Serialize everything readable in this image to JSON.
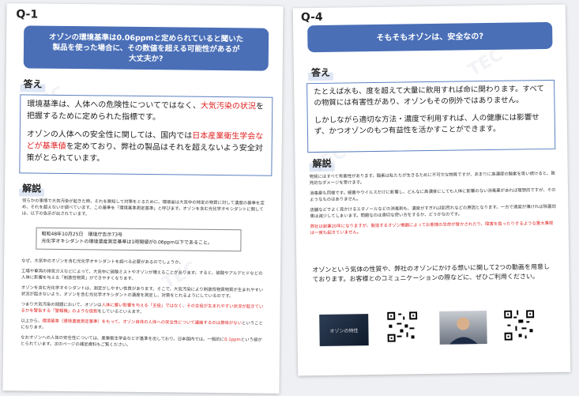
{
  "page1": {
    "qid": "Q-1",
    "question": [
      "オゾンの環境基準は0.06ppmと定められていると聞いた",
      "製品を使った場合に、その数値を超える可能性があるが",
      "大丈夫か?"
    ],
    "answer_heading": "答え",
    "answer": {
      "p1_a": "環境基準は、人体への危険性についてではなく、",
      "p1_red": "大気汚染の状況",
      "p1_b": "を把握するために定められた指標です。",
      "p2_a": "オゾンの人体への安全性に関しては、国内では",
      "p2_red": "日本産業衛生学会などが基準値",
      "p2_b": "を定めており、弊社の製品はそれを超えないよう安全対策がとられています。"
    },
    "explain_heading": "解説",
    "explain_1": "何らかの事情で大気汚染が起きた時、それを察知して対策をとるために、環境省は大気中の特定の物質に対して濃度の基準を定め、それを超えないか調べています。この基準を「環境基準測定基準」と呼びます。オゾンを含む光化学オキシダントに関しては、以下の告示が出されています。",
    "notice_1": "昭和48年10月25日　環境庁告示73号",
    "notice_2": "光化学オキシダントの環境濃度測定基準は1時間値が0.06ppm以下であること。",
    "explain_2": "なぜ、大気中のオゾンを含む光化学オキシダントを調べる必要があるのでしょうか。",
    "explain_3": "工場や車両の排気ガスなどによって、大気中に硫酸ミストやオゾンが増えることがあります。すると、硫酸やアルデヒドなどの人体に影響を与える「刺激性物質」ができやすくなります。",
    "explain_4": "オゾンを含む光化学オキシダントは、測定がしやすい性質があります。そこで、大気汚染により刺激性物質物質が生まれやすい状況が起きないよう、オゾンを含む光化学オキシダントの濃度を測定し、対策をとれるようにしているのです。",
    "explain_5_a": "つまり大気汚染の問題において、オゾンは",
    "explain_5_red": "人体に悪い影響を与える「主役」ではなく、その主役が生まれやすい状況が起きているかを警告する「警報機」のような役割",
    "explain_5_b": "をしているといえます。",
    "explain_6_a": "以上から、",
    "explain_6_red": "環境基準（環境濃度測定基準）をもって、オゾン自体の人体への安全性について議論するのは意味がない",
    "explain_6_b": "ということになります。",
    "explain_7_a": "なおオゾンへの人体の安全性については、産業衛生学会などが基準を出しており、日本国内では、一般的に",
    "explain_7_red": "0.1ppm",
    "explain_7_b": "という値がとられています。次のページの補足資料もご覧ください。"
  },
  "page2": {
    "qid": "Q-4",
    "question": "そもそもオゾンは、安全なの?",
    "answer_heading": "答え",
    "answer_p1": "たとえば水も、度を超えて大量に飲用すれば命に関わります。すべての物質には有害性があり、オゾンもその例外ではありません。",
    "answer_p2": "しかしながら適切な方法・濃度で利用すれば、人の健康には影響せず、かつオゾンのもつ有益性を活かすことができます。",
    "explain_heading": "解説",
    "explain_1": "物質にはすべて有害性があります。酸素は私たちが生きるために不可欠な物質ですが、あまりに高濃度の酸素を吸い続けると、致死的なダメージを受けます。",
    "explain_2": "消毒薬も同様です。細菌やウイルスだけに影響し、どんなに高濃度にしても人体に影響のない消毒薬があれば理想的ですが、そのようなものはありません。",
    "explain_3": "店舗などでよく見かけるエタノールなどの消毒剤も、濃度がすぎれば肌荒れなどの原因となります。一方で適度が薄ければ除菌効果は減少してしまいます。問題なのは適切な使い方をするか、どうかなのです。",
    "explain_red": "弊社は創業20年になりますが、製造するオゾン機器によってお客様の生命が脅かされたり、障害を負ったりするような重大事故は一度も起きていません。",
    "video_text": "オゾンという気体の性質や、弊社のオゾンにかける想いに関して2つの動画を用意しております。お客様とのコミュニケーションの際などに、ぜひご利用ください。",
    "video1_title": "オゾンの特性"
  }
}
